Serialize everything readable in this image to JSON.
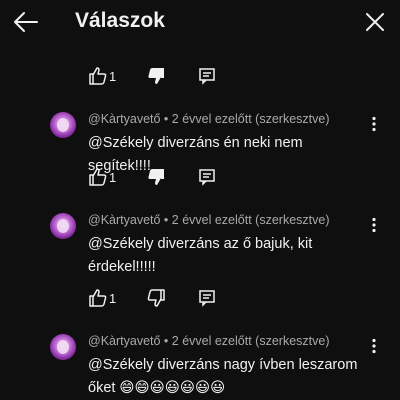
{
  "header": {
    "title": "Válaszok",
    "back_icon": "arrow-left-icon",
    "close_icon": "close-icon"
  },
  "colors": {
    "background": "#0f0f0f",
    "text": "#f1f1f1",
    "secondary_text": "#aaaaaa"
  },
  "previous_comment": {
    "likes": "1"
  },
  "comments": [
    {
      "author": "@Kàrtyavető",
      "time": "2 évvel ezelőtt (szerkesztve)",
      "separator": " • ",
      "text_lines": [
        "@Székely diverzáns én neki nem segítek!!!!"
      ],
      "likes": "1"
    },
    {
      "author": "@Kàrtyavető",
      "time": "2 évvel ezelőtt (szerkesztve)",
      "separator": " • ",
      "text_lines": [
        "@Székely diverzáns az ő bajuk, kit",
        "érdekel!!!!!"
      ],
      "likes": "1"
    },
    {
      "author": "@Kàrtyavető",
      "time": "2 évvel ezelőtt (szerkesztve)",
      "separator": " • ",
      "text_lines": [
        "@Székely diverzáns nagy ívben leszarom",
        "őket 😄😄😃😃😃😃😃"
      ]
    }
  ]
}
